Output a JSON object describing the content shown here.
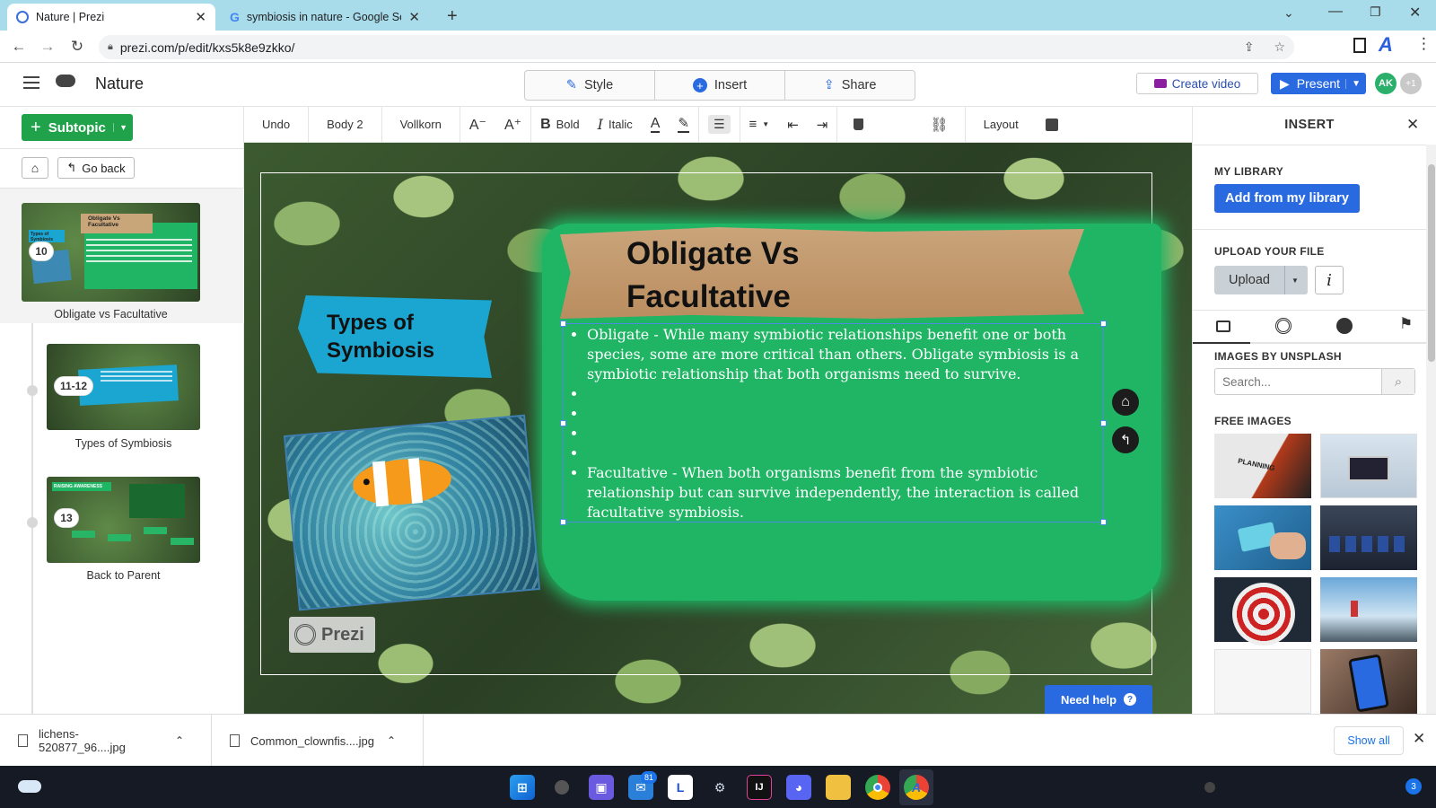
{
  "browser": {
    "tabs": [
      {
        "title": "Nature | Prezi",
        "active": true
      },
      {
        "title": "symbiosis in nature - Google Sea",
        "active": false
      }
    ],
    "url": "prezi.com/p/edit/kxs5k8e9zkko/"
  },
  "header": {
    "title": "Nature",
    "style_label": "Style",
    "insert_label": "Insert",
    "share_label": "Share",
    "create_video_label": "Create video",
    "present_label": "Present",
    "avatar_initials": "AK",
    "avatar_more": "+1"
  },
  "left": {
    "subtopic_label": "Subtopic",
    "go_back_label": "Go back",
    "slides": [
      {
        "badge": "10",
        "caption": "Obligate vs Facultative",
        "mini_title": "Obligate Vs Facultative",
        "mini_sub": "Types of Symbiosis"
      },
      {
        "badge": "11-12",
        "caption": "Types of Symbiosis"
      },
      {
        "badge": "13",
        "caption": "Back to Parent",
        "mini_title": "RAISING AWARENESS"
      }
    ]
  },
  "toolbar": {
    "undo": "Undo",
    "style": "Body 2",
    "font": "Vollkorn",
    "bold": "Bold",
    "italic": "Italic",
    "layout": "Layout"
  },
  "canvas": {
    "title_line1": "Obligate Vs",
    "title_line2": "Facultative",
    "side_title_line1": "Types of",
    "side_title_line2": "Symbiosis",
    "bullet1": "Obligate - While many symbiotic relationships benefit one or both species, some are more critical than others. Obligate symbiosis is a symbiotic relationship that both organisms need to survive.",
    "bullet2": "Facultative - When both organisms benefit from the symbiotic relationship but can survive independently, the interaction is called facultative symbiosis.",
    "watermark": "Prezi",
    "need_help": "Need help"
  },
  "right": {
    "title": "INSERT",
    "my_library": "MY LIBRARY",
    "add_library": "Add from my library",
    "upload_file": "UPLOAD YOUR FILE",
    "upload": "Upload",
    "images_by": "IMAGES BY UNSPLASH",
    "search_placeholder": "Search...",
    "free_images": "FREE IMAGES",
    "image_word": "PLANNING"
  },
  "downloads": {
    "items": [
      "lichens-520877_96....jpg",
      "Common_clownfis....jpg"
    ],
    "show_all": "Show all"
  },
  "taskbar": {
    "mail_badge": "81",
    "notif_count": "3"
  },
  "colors": {
    "prezi_green": "#1fa24a",
    "prezi_blue": "#2a6ae0",
    "slide_green": "#1fb564",
    "cyan_banner": "#1aa6d0"
  }
}
